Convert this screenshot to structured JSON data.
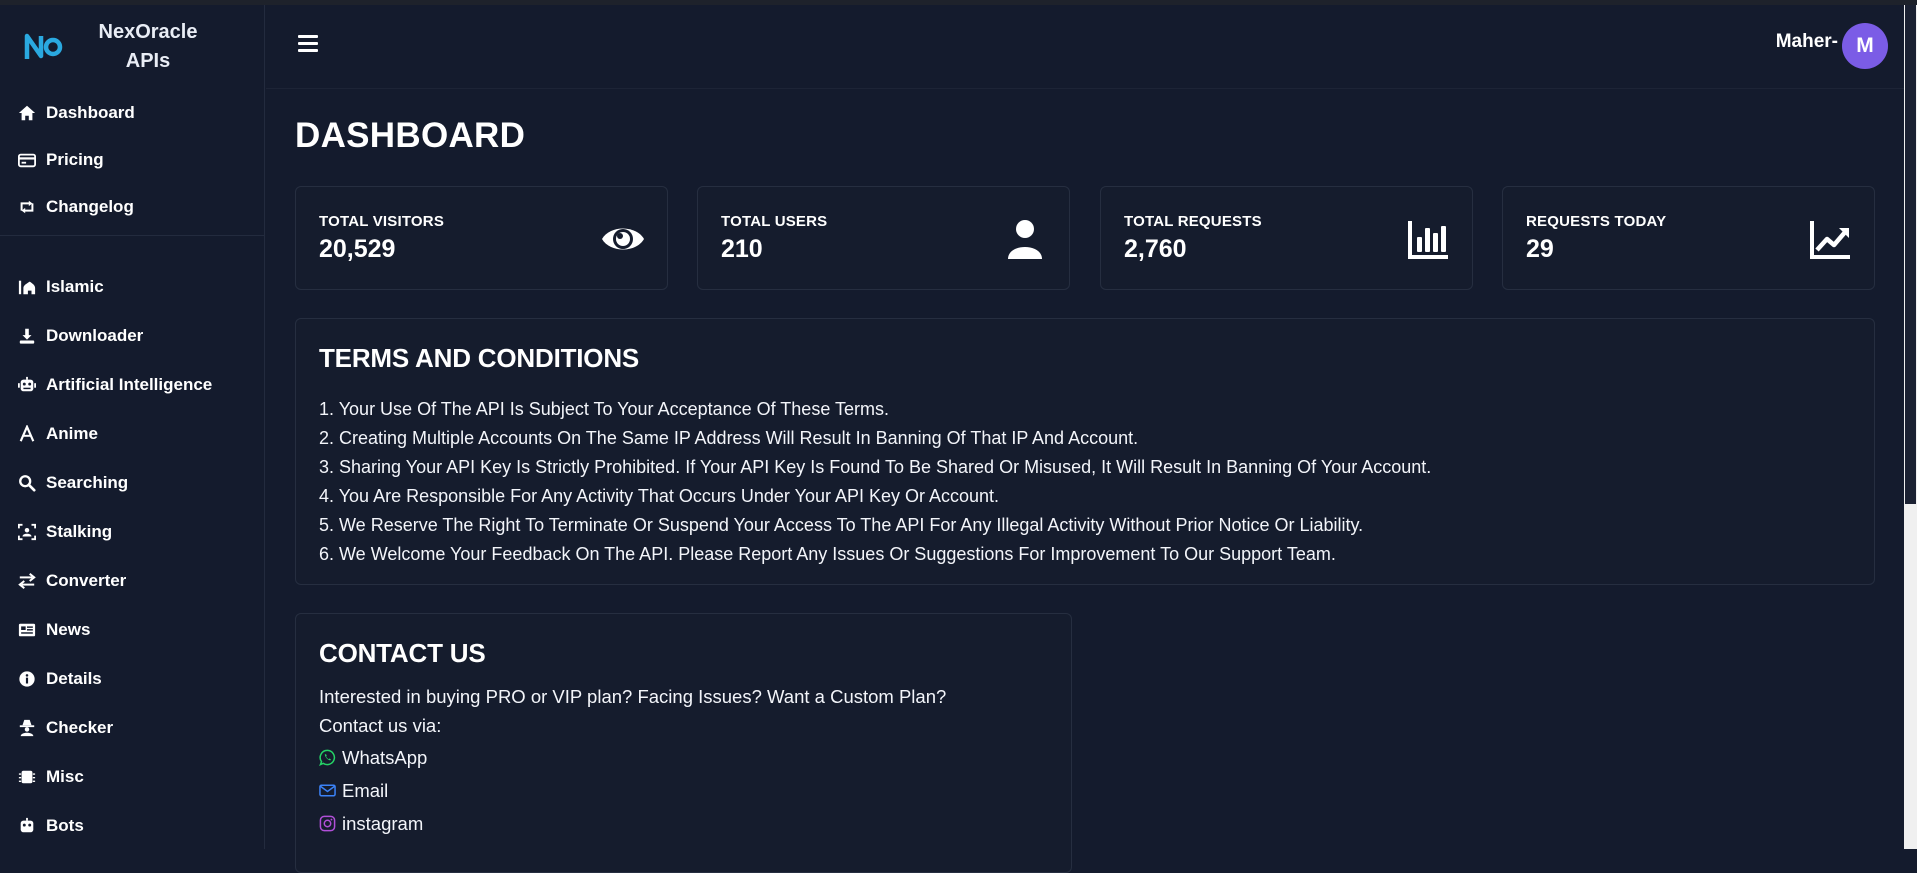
{
  "brand": {
    "line1": "NexOracle",
    "line2": "APIs"
  },
  "sidebar": {
    "primary": [
      {
        "label": "Dashboard",
        "icon": "home-icon"
      },
      {
        "label": "Pricing",
        "icon": "credit-card-icon"
      },
      {
        "label": "Changelog",
        "icon": "sync-icon"
      }
    ],
    "categories": [
      {
        "label": "Islamic",
        "icon": "mosque-icon"
      },
      {
        "label": "Downloader",
        "icon": "download-icon"
      },
      {
        "label": "Artificial Intelligence",
        "icon": "robot-icon"
      },
      {
        "label": "Anime",
        "icon": "letter-a-icon"
      },
      {
        "label": "Searching",
        "icon": "search-icon"
      },
      {
        "label": "Stalking",
        "icon": "scan-icon"
      },
      {
        "label": "Converter",
        "icon": "exchange-icon"
      },
      {
        "label": "News",
        "icon": "newspaper-icon"
      },
      {
        "label": "Details",
        "icon": "info-icon"
      },
      {
        "label": "Checker",
        "icon": "spy-icon"
      },
      {
        "label": "Misc",
        "icon": "chip-icon"
      },
      {
        "label": "Bots",
        "icon": "robot-icon"
      }
    ]
  },
  "topbar": {
    "user_name": "Maher-",
    "avatar_letter": "M"
  },
  "page": {
    "title": "DASHBOARD"
  },
  "stats": [
    {
      "label": "TOTAL VISITORS",
      "value": "20,529",
      "icon": "eye-icon"
    },
    {
      "label": "TOTAL USERS",
      "value": "210",
      "icon": "user-icon"
    },
    {
      "label": "TOTAL REQUESTS",
      "value": "2,760",
      "icon": "bar-chart-icon"
    },
    {
      "label": "REQUESTS TODAY",
      "value": "29",
      "icon": "trend-up-icon"
    }
  ],
  "terms": {
    "title": "TERMS AND CONDITIONS",
    "items": [
      "1. Your Use Of The API Is Subject To Your Acceptance Of These Terms.",
      "2. Creating Multiple Accounts On The Same IP Address Will Result In Banning Of That IP And Account.",
      "3. Sharing Your API Key Is Strictly Prohibited. If Your API Key Is Found To Be Shared Or Misused, It Will Result In Banning Of Your Account.",
      "4. You Are Responsible For Any Activity That Occurs Under Your API Key Or Account.",
      "5. We Reserve The Right To Terminate Or Suspend Your Access To The API For Any Illegal Activity Without Prior Notice Or Liability.",
      "6. We Welcome Your Feedback On The API. Please Report Any Issues Or Suggestions For Improvement To Our Support Team."
    ]
  },
  "contact": {
    "title": "CONTACT US",
    "intro": "Interested in buying PRO or VIP plan? Facing Issues? Want a Custom Plan?",
    "via": "Contact us via:",
    "links": [
      {
        "label": "WhatsApp",
        "icon": "whatsapp-icon",
        "color": "#25d366"
      },
      {
        "label": "Email",
        "icon": "envelope-icon",
        "color": "#3b82f6"
      },
      {
        "label": "instagram",
        "icon": "instagram-icon",
        "color": "#b14fd8"
      }
    ]
  },
  "colors": {
    "background": "#141b2d",
    "card_border": "#262e40",
    "avatar": "#7b5ce6",
    "logo": "#2aa9e0"
  }
}
